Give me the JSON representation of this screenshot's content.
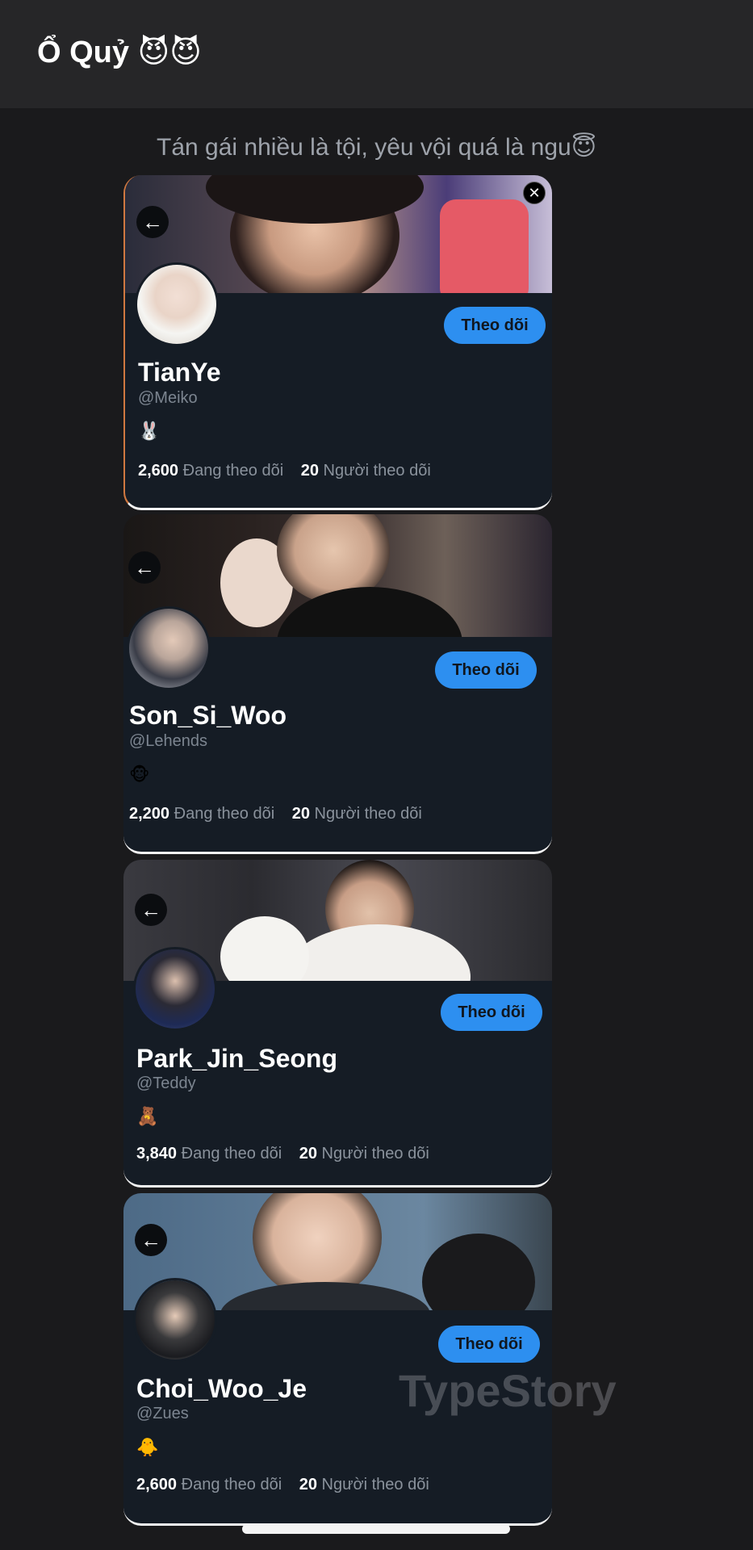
{
  "header": {
    "title": "Ổ Quỷ 😈😈"
  },
  "subtitle": "Tán gái nhiều là tội, yêu vội quá là ngu😇",
  "follow_label": "Theo dõi",
  "following_label": "Đang theo dõi",
  "followers_label": "Người theo dõi",
  "profiles": [
    {
      "name": "TianYe",
      "handle": "@Meiko",
      "bio": "🐰",
      "following": "2,600",
      "followers": "20"
    },
    {
      "name": "Son_Si_Woo",
      "handle": "@Lehends",
      "bio": "🐵",
      "following": "2,200",
      "followers": "20"
    },
    {
      "name": "Park_Jin_Seong",
      "handle": "@Teddy",
      "bio": "🧸",
      "following": "3,840",
      "followers": "20"
    },
    {
      "name": "Choi_Woo_Je",
      "handle": "@Zues",
      "bio": "🐥",
      "following": "2,600",
      "followers": "20"
    }
  ],
  "watermark": "TypeStory",
  "colors": {
    "accent_button": "#2d8ff0",
    "card_bg": "#151c25",
    "page_bg": "#1a1a1c"
  }
}
